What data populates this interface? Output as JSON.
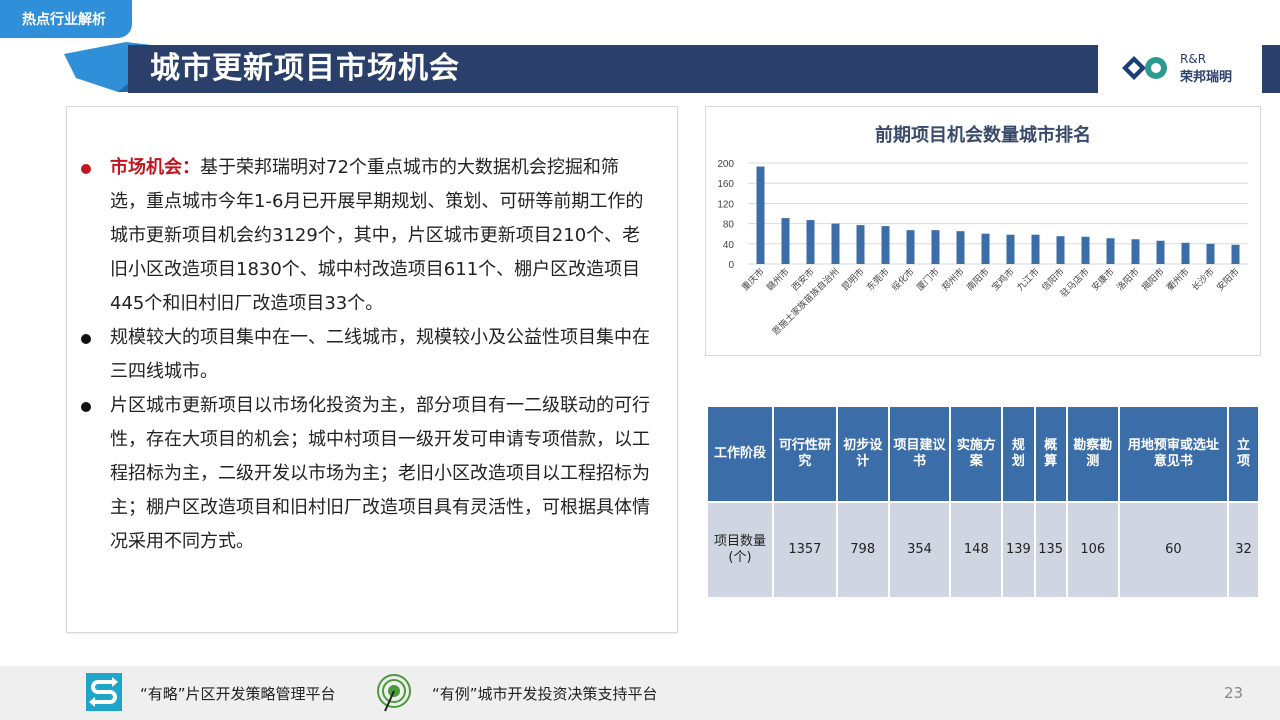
{
  "header": {
    "tag": "热点行业解析",
    "title": "城市更新项目市场机会",
    "logo_line1": "R&R",
    "logo_line2": "荣邦瑞明"
  },
  "bullets": [
    {
      "highlight": "市场机会：",
      "text": "基于荣邦瑞明对72个重点城市的大数据机会挖掘和筛选，重点城市今年1-6月已开展早期规划、策划、可研等前期工作的城市更新项目机会约3129个，其中，片区城市更新项目210个、老旧小区改造项目1830个、城中村改造项目611个、棚户区改造项目445个和旧村旧厂改造项目33个。"
    },
    {
      "highlight": "",
      "text": "规模较大的项目集中在一、二线城市，规模较小及公益性项目集中在三四线城市。"
    },
    {
      "highlight": "",
      "text": "片区城市更新项目以市场化投资为主，部分项目有一二级联动的可行性，存在大项目的机会；城中村项目一级开发可申请专项借款，以工程招标为主，二级开发以市场为主；老旧小区改造项目以工程招标为主；棚户区改造项目和旧村旧厂改造项目具有灵活性，可根据具体情况采用不同方式。"
    }
  ],
  "chart_data": {
    "type": "bar",
    "title": "前期项目机会数量城市排名",
    "categories": [
      "重庆市",
      "赣州市",
      "西安市",
      "恩施土家族苗族自治州",
      "昆明市",
      "东莞市",
      "绥化市",
      "厦门市",
      "郑州市",
      "南阳市",
      "宝鸡市",
      "九江市",
      "信阳市",
      "驻马店市",
      "安康市",
      "洛阳市",
      "揭阳市",
      "衢州市",
      "长沙市",
      "安阳市"
    ],
    "values": [
      193,
      91,
      87,
      80,
      77,
      75,
      67,
      67,
      65,
      60,
      58,
      58,
      55,
      54,
      51,
      49,
      46,
      42,
      40,
      38
    ],
    "yticks": [
      0,
      40,
      80,
      120,
      160,
      200
    ],
    "ylim": [
      0,
      200
    ],
    "grid": true,
    "bar_color": "#3b6ea8"
  },
  "table": {
    "row1_label": "工作阶段",
    "headers": [
      "可行性研究",
      "初步设计",
      "项目建议书",
      "实施方案",
      "规划",
      "概算",
      "勘察勘测",
      "用地预审或选址意见书",
      "立项"
    ],
    "row2_label": "项目数量(个)",
    "values": [
      "1357",
      "798",
      "354",
      "148",
      "139",
      "135",
      "106",
      "60",
      "32"
    ]
  },
  "footer": {
    "text1": "“有略”片区开发策略管理平台",
    "text2": "“有例”城市开发投资决策支持平台",
    "page_number": "23"
  }
}
